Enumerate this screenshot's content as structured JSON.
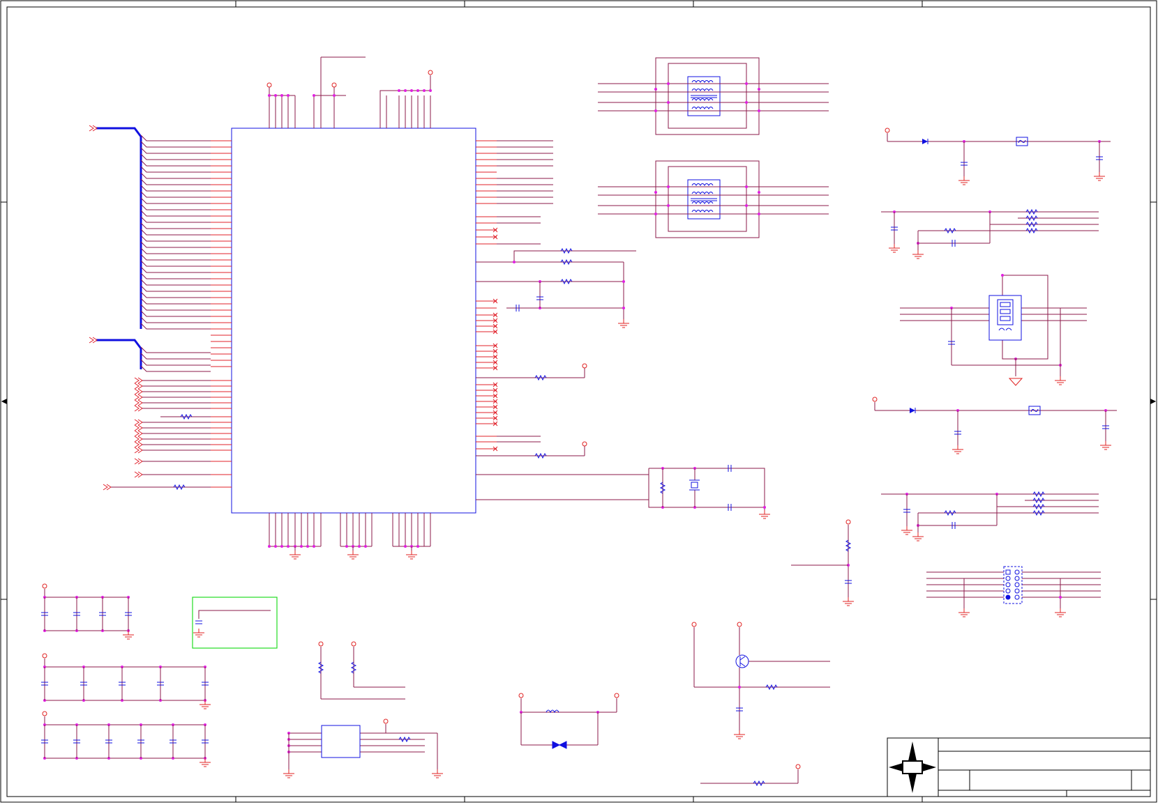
{
  "schematic": {
    "sheet_label": "",
    "title_block": {
      "title": "",
      "document_number": "",
      "revision": "",
      "sheet": ""
    },
    "colors": {
      "wire": "#8b1a4a",
      "pin": "#e0202a",
      "part": "#1010e0",
      "junction": "#e020e0",
      "power_port": "#e02020",
      "note_box": "#22dd22",
      "border": "#000000"
    },
    "components": {
      "main_ic": "ic",
      "transformers": [
        "transformer",
        "transformer"
      ],
      "usb_connector": "usb-connector",
      "pin_header": "pin-header",
      "crystal": "crystal",
      "transistor": "transistor",
      "regulator": "ic"
    }
  }
}
